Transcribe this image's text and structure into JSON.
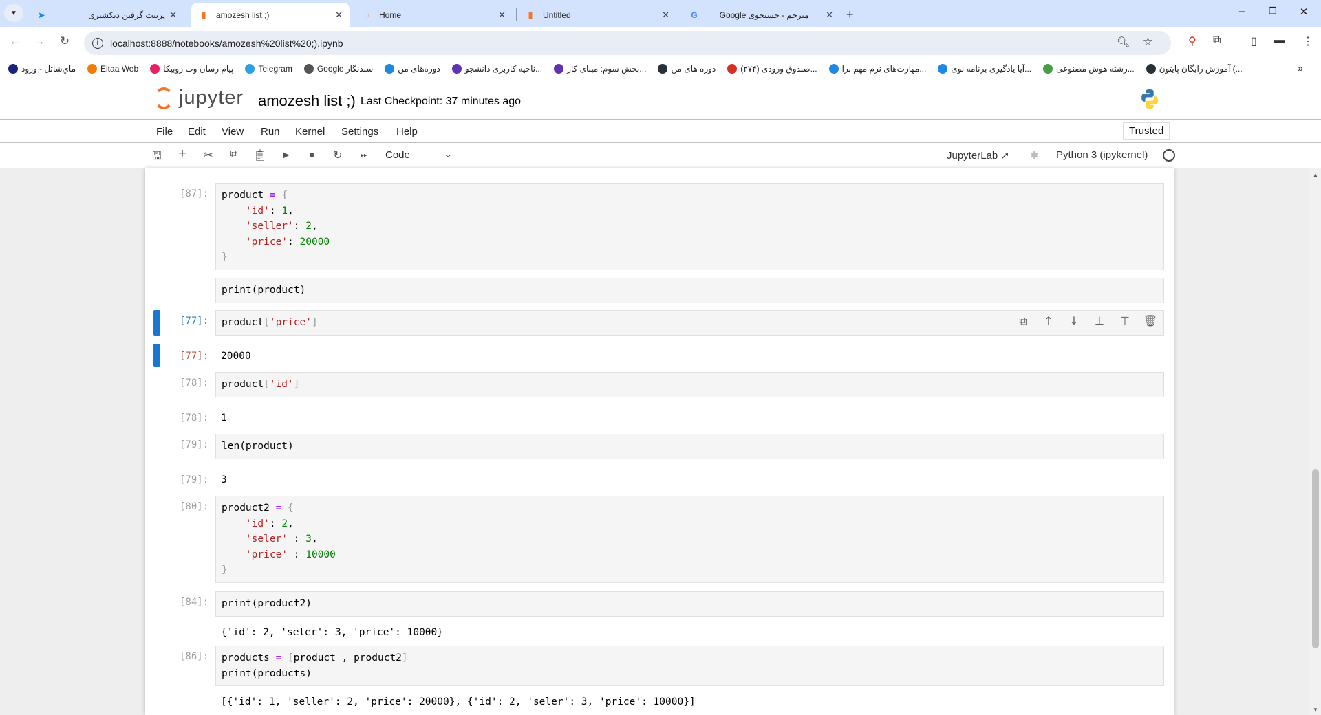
{
  "browser": {
    "tabs": [
      {
        "title": "پرینت گرفتن دیکشنری",
        "icon": "bookmark-blue-icon",
        "active": false
      },
      {
        "title": "amozesh list ;)",
        "icon": "jupyter-notebook-icon",
        "active": true
      },
      {
        "title": "Home",
        "icon": "jupyter-icon",
        "active": false
      },
      {
        "title": "Untitled",
        "icon": "jupyter-notebook-icon",
        "active": false
      },
      {
        "title": "Google مترجم - جستجوی",
        "icon": "google-icon",
        "active": false
      }
    ],
    "url": "localhost:8888/notebooks/amozesh%20list%20;).ipynb",
    "bookmarks": [
      {
        "label": "ماي‌شاتل - ورود",
        "color": "#1a237e"
      },
      {
        "label": "Eitaa Web",
        "color": "#f57c00"
      },
      {
        "label": "پیام رسان وب روبیکا",
        "color": "#e91e63"
      },
      {
        "label": "Telegram",
        "color": "#2aa3df"
      },
      {
        "label": "Google سندنگار",
        "color": "#555555"
      },
      {
        "label": "دوره‌های من",
        "color": "#1e88e5"
      },
      {
        "label": "ناحیه کاربری دانشجو...",
        "color": "#5e35b1"
      },
      {
        "label": "بخش سوم: مبنای کار...",
        "color": "#5e35b1"
      },
      {
        "label": "دوره های من",
        "color": "#263238"
      },
      {
        "label": "صندوق ورودی (۲۷۴)...",
        "color": "#d93025"
      },
      {
        "label": "مهارت‌های نرم مهم برا...",
        "color": "#1e88e5"
      },
      {
        "label": "آیا یادگیری برنامه نوی...",
        "color": "#1e88e5"
      },
      {
        "label": "رشته هوش مصنوعی...",
        "color": "#43a047"
      },
      {
        "label": "آموزش رایگان پایتون (...",
        "color": "#263238"
      }
    ]
  },
  "jupyter": {
    "logo_text": "jupyter",
    "notebook_title": "amozesh list ;)",
    "checkpoint": "Last Checkpoint: 37 minutes ago",
    "menu": [
      "File",
      "Edit",
      "View",
      "Run",
      "Kernel",
      "Settings",
      "Help"
    ],
    "trusted": "Trusted",
    "cell_type": "Code",
    "jupyterlab_link": "JupyterLab",
    "kernel": "Python 3 (ipykernel)"
  },
  "cells": [
    {
      "prompt": "[87]:",
      "selected": false,
      "code": [
        [
          [
            "product ",
            ""
          ],
          [
            "=",
            "op"
          ],
          [
            " ",
            ""
          ],
          [
            "{",
            "br"
          ]
        ],
        [
          [
            "    ",
            ""
          ],
          [
            "'id'",
            "str"
          ],
          [
            ": ",
            ""
          ],
          [
            "1",
            "num"
          ],
          [
            ",",
            ""
          ]
        ],
        [
          [
            "    ",
            ""
          ],
          [
            "'seller'",
            "str"
          ],
          [
            ": ",
            ""
          ],
          [
            "2",
            "num"
          ],
          [
            ",",
            ""
          ]
        ],
        [
          [
            "    ",
            ""
          ],
          [
            "'price'",
            "str"
          ],
          [
            ": ",
            ""
          ],
          [
            "20000",
            "num"
          ]
        ],
        [
          [
            "}",
            "br"
          ]
        ]
      ]
    },
    {
      "prompt": "",
      "selected": false,
      "code": [
        [
          [
            "print(product)",
            ""
          ]
        ]
      ]
    },
    {
      "prompt": "[77]:",
      "selected": true,
      "out_prompt": "[77]:",
      "output": "20000",
      "code": [
        [
          [
            "product",
            ""
          ],
          [
            "[",
            "br"
          ],
          [
            "'price'",
            "str"
          ],
          [
            "]",
            "br"
          ]
        ]
      ]
    },
    {
      "prompt": "[78]:",
      "selected": false,
      "out_prompt": "[78]:",
      "output": "1",
      "code": [
        [
          [
            "product",
            ""
          ],
          [
            "[",
            "br"
          ],
          [
            "'id'",
            "str"
          ],
          [
            "]",
            "br"
          ]
        ]
      ]
    },
    {
      "prompt": "[79]:",
      "selected": false,
      "out_prompt": "[79]:",
      "output": "3",
      "code": [
        [
          [
            "len(product)",
            ""
          ]
        ]
      ]
    },
    {
      "prompt": "[80]:",
      "selected": false,
      "code": [
        [
          [
            "product2 ",
            ""
          ],
          [
            "=",
            "op"
          ],
          [
            " ",
            ""
          ],
          [
            "{",
            "br"
          ]
        ],
        [
          [
            "    ",
            ""
          ],
          [
            "'id'",
            "str"
          ],
          [
            ": ",
            ""
          ],
          [
            "2",
            "num"
          ],
          [
            ",",
            ""
          ]
        ],
        [
          [
            "    ",
            ""
          ],
          [
            "'seler'",
            "str"
          ],
          [
            " : ",
            ""
          ],
          [
            "3",
            "num"
          ],
          [
            ",",
            ""
          ]
        ],
        [
          [
            "    ",
            ""
          ],
          [
            "'price'",
            "str"
          ],
          [
            " : ",
            ""
          ],
          [
            "10000",
            "num"
          ]
        ],
        [
          [
            "}",
            "br"
          ]
        ]
      ]
    },
    {
      "prompt": "[84]:",
      "selected": false,
      "output": "{'id': 2, 'seler': 3, 'price': 10000}",
      "code": [
        [
          [
            "print(product2)",
            ""
          ]
        ]
      ]
    },
    {
      "prompt": "[86]:",
      "selected": false,
      "output": "[{'id': 1, 'seller': 2, 'price': 20000}, {'id': 2, 'seler': 3, 'price': 10000}]",
      "code": [
        [
          [
            "products ",
            ""
          ],
          [
            "=",
            "op"
          ],
          [
            " ",
            ""
          ],
          [
            "[",
            "br"
          ],
          [
            "product , product2",
            ""
          ],
          [
            "]",
            "br"
          ]
        ],
        [
          [
            "print(products)",
            ""
          ]
        ]
      ]
    }
  ],
  "cell_toolbar": [
    "duplicate-cell-icon",
    "move-up-icon",
    "move-down-icon",
    "insert-above-icon",
    "insert-below-icon",
    "delete-cell-icon"
  ]
}
